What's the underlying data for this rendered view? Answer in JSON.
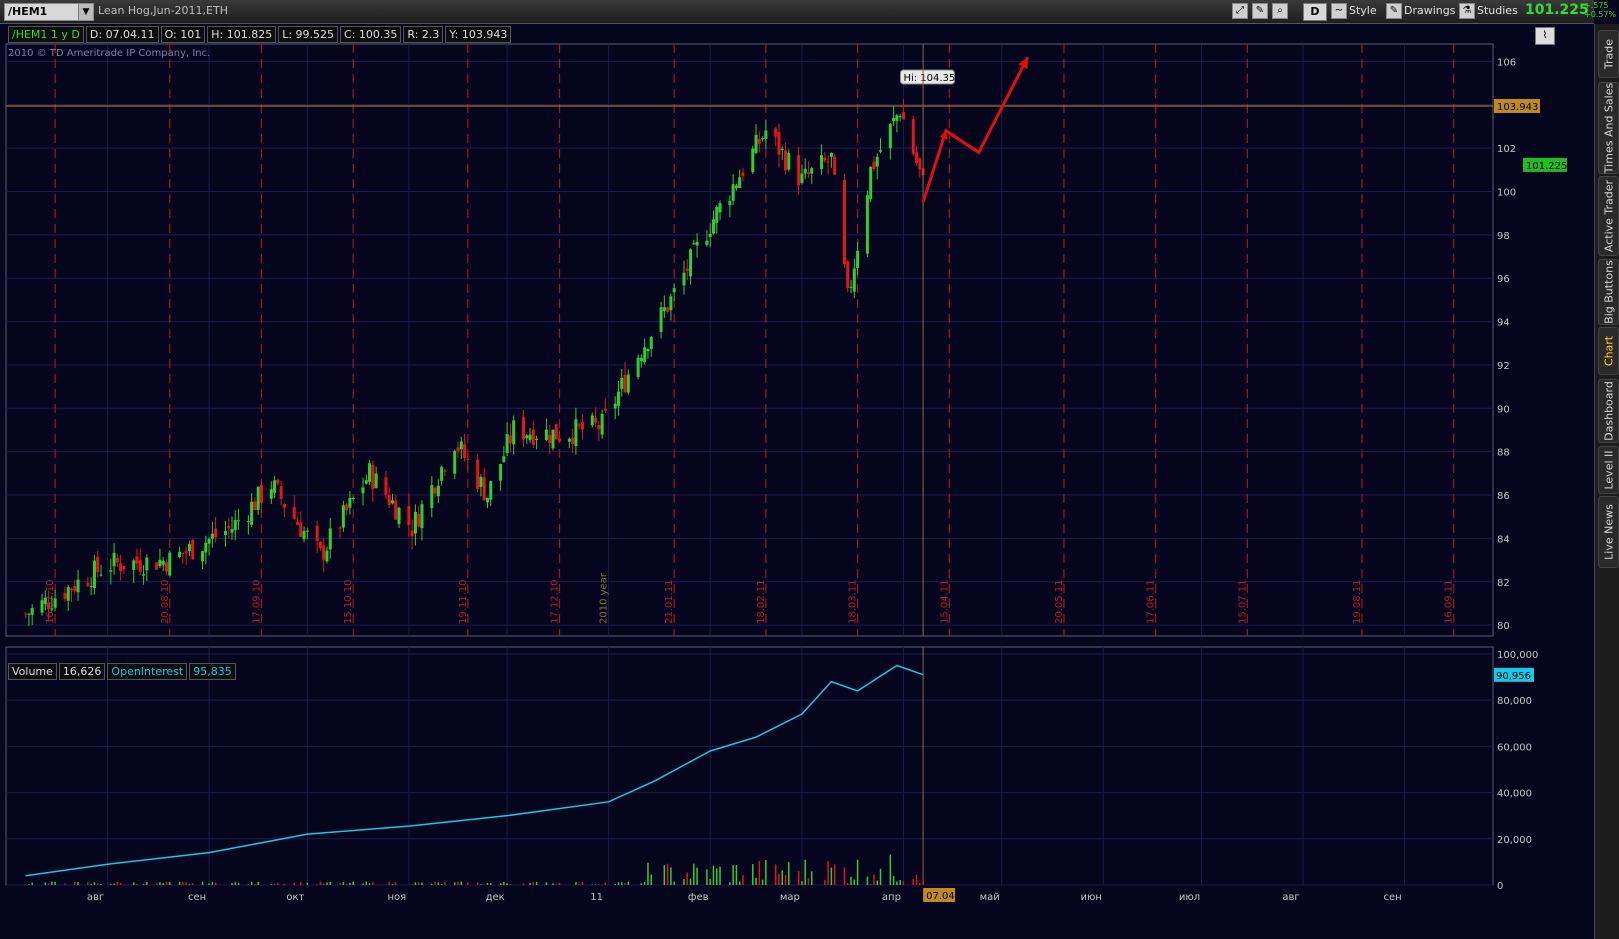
{
  "toolbar": {
    "symbol": "/HEM1",
    "title": "Lean Hog,Jun-2011,ETH",
    "period_button": "D",
    "style_label": "Style",
    "drawings_label": "Drawings",
    "studies_label": "Studies",
    "last_price": "101.225",
    "change_abs": "+.575",
    "change_pct": "+0.57%"
  },
  "info_bar": {
    "symbol_period": "/HEM1 1 y D",
    "date": "D: 07.04.11",
    "open": "O: 101",
    "high": "H: 101.825",
    "low": "L: 99.525",
    "close": "C: 100.35",
    "range": "R: 2.3",
    "y": "Y: 103.943"
  },
  "copyright": "2010 © TD Ameritrade IP Company, Inc.",
  "side_tabs": [
    "Trade",
    "Times And Sales",
    "Active Trader",
    "Big Buttons",
    "Chart",
    "Dashboard",
    "Level II",
    "Live News"
  ],
  "active_side_tab": "Chart",
  "colors": {
    "background": "#05051e",
    "up_candle": "#33cc33",
    "down_candle": "#e01818",
    "grid_dashed": "#a8141e",
    "open_interest": "#18c8e8",
    "annotation_arrow": "#e01010",
    "crosshair_level": "#c08a20"
  },
  "chart_data": [
    {
      "type": "candlestick",
      "title": "/HEM1 1 y D",
      "ylim": [
        79.5,
        106.8
      ],
      "y_ticks": [
        "80",
        "82",
        "84",
        "86",
        "88",
        "90",
        "92",
        "94",
        "96",
        "98",
        "100",
        "102",
        "104",
        "106"
      ],
      "x_period_labels": [
        "16.07.10",
        "20.08.10",
        "17.09.10",
        "15.10.10",
        "19.11.10",
        "17.12.10",
        "2010 year",
        "21.01.11",
        "18.02.11",
        "18.03.11",
        "15.04.11",
        "20.05.11",
        "17.06.11",
        "15.07.11",
        "19.08.11",
        "16.09.11"
      ],
      "hi_label": "Hi: 104.35",
      "horizontal_level": {
        "value": 103.943,
        "label": "103.943"
      },
      "last_price_label": "101.225",
      "grid": true,
      "trend_anchors": [
        {
          "date": "2010-07-07",
          "close": 80.5
        },
        {
          "date": "2010-08-01",
          "close": 82.8
        },
        {
          "date": "2010-08-20",
          "close": 83.0
        },
        {
          "date": "2010-09-08",
          "close": 84.5
        },
        {
          "date": "2010-09-20",
          "close": 86.5
        },
        {
          "date": "2010-10-05",
          "close": 83.2
        },
        {
          "date": "2010-10-20",
          "close": 87.0
        },
        {
          "date": "2010-11-02",
          "close": 84.5
        },
        {
          "date": "2010-11-15",
          "close": 88.5
        },
        {
          "date": "2010-11-25",
          "close": 86.0
        },
        {
          "date": "2010-12-03",
          "close": 89.0
        },
        {
          "date": "2010-12-17",
          "close": 88.8
        },
        {
          "date": "2010-12-30",
          "close": 89.2
        },
        {
          "date": "2011-01-10",
          "close": 92.5
        },
        {
          "date": "2011-01-20",
          "close": 95.0
        },
        {
          "date": "2011-02-01",
          "close": 98.5
        },
        {
          "date": "2011-02-18",
          "close": 102.8
        },
        {
          "date": "2011-03-01",
          "close": 100.5
        },
        {
          "date": "2011-03-10",
          "close": 101.5
        },
        {
          "date": "2011-03-15",
          "close": 95.0
        },
        {
          "date": "2011-03-22",
          "close": 101.0
        },
        {
          "date": "2011-03-31",
          "close": 103.8
        },
        {
          "date": "2011-04-07",
          "close": 100.35
        }
      ],
      "projection_points": [
        {
          "date": "2011-04-07",
          "value": 99.5
        },
        {
          "date": "2011-04-14",
          "value": 102.8
        },
        {
          "date": "2011-04-24",
          "value": 101.8
        },
        {
          "date": "2011-05-09",
          "value": 106.2
        }
      ]
    },
    {
      "type": "bar+line",
      "legend": [
        "Volume",
        "OpenInterest"
      ],
      "volume_last": "16,626",
      "open_interest_last": "95,835",
      "open_interest_right_label": "90,956",
      "ylim": [
        0,
        103000
      ],
      "y_ticks": [
        "0",
        "20,000",
        "40,000",
        "60,000",
        "80,000",
        "100,000"
      ],
      "x_month_labels": [
        "авг",
        "сен",
        "окт",
        "ноя",
        "дек",
        "11",
        "фев",
        "мар",
        "апр",
        "май",
        "июн",
        "июл",
        "авг",
        "сен"
      ],
      "current_date_label": "07.04",
      "open_interest_series": [
        {
          "date": "2010-07-07",
          "value": 4000
        },
        {
          "date": "2010-08-01",
          "value": 9000
        },
        {
          "date": "2010-09-01",
          "value": 14000
        },
        {
          "date": "2010-10-01",
          "value": 22000
        },
        {
          "date": "2010-11-01",
          "value": 25500
        },
        {
          "date": "2010-12-01",
          "value": 30000
        },
        {
          "date": "2011-01-01",
          "value": 36000
        },
        {
          "date": "2011-01-15",
          "value": 45000
        },
        {
          "date": "2011-02-01",
          "value": 58000
        },
        {
          "date": "2011-02-15",
          "value": 64000
        },
        {
          "date": "2011-03-01",
          "value": 74000
        },
        {
          "date": "2011-03-10",
          "value": 88000
        },
        {
          "date": "2011-03-18",
          "value": 84000
        },
        {
          "date": "2011-03-30",
          "value": 95000
        },
        {
          "date": "2011-04-07",
          "value": 91000
        }
      ]
    }
  ]
}
